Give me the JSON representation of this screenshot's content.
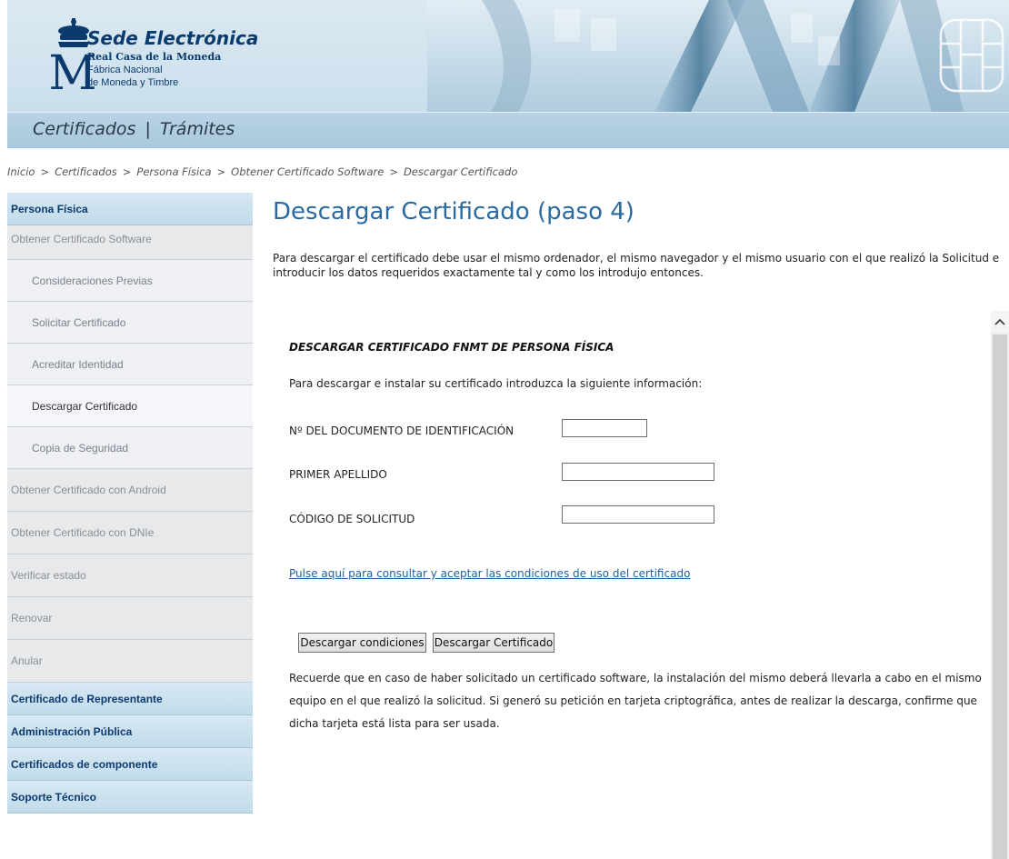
{
  "header": {
    "brand_title": "Sede Electrónica",
    "brand_sub1": "Real Casa de la Moneda",
    "brand_sub2": "Fábrica Nacional",
    "brand_sub3": "de Moneda y Timbre",
    "logo_letter": "M",
    "nav": {
      "certificados": "Certificados",
      "separator": "|",
      "tramites": "Trámites"
    }
  },
  "breadcrumb": {
    "separator": ">",
    "items": [
      "Inicio",
      "Certificados",
      "Persona Física",
      "Obtener Certificado Software",
      "Descargar Certificado"
    ]
  },
  "sidebar": {
    "items": [
      {
        "label": "Persona Física"
      },
      {
        "label": "Obtener Certificado Software"
      },
      {
        "label": "Consideraciones Previas"
      },
      {
        "label": "Solicitar Certificado"
      },
      {
        "label": "Acreditar Identidad"
      },
      {
        "label": "Descargar Certificado"
      },
      {
        "label": "Copia de Seguridad"
      },
      {
        "label": "Obtener Certificado con Android"
      },
      {
        "label": "Obtener Certificado con DNIe"
      },
      {
        "label": "Verificar estado"
      },
      {
        "label": "Renovar"
      },
      {
        "label": "Anular"
      },
      {
        "label": "Certificado de Representante"
      },
      {
        "label": "Administración Pública"
      },
      {
        "label": "Certificados de componente"
      },
      {
        "label": "Soporte Técnico"
      }
    ]
  },
  "main": {
    "title": "Descargar Certificado (paso 4)",
    "intro": "Para descargar el certificado debe usar el mismo ordenador, el mismo navegador y el mismo usuario con el que realizó la Solicitud e introducir los datos requeridos exactamente tal y como los introdujo entonces.",
    "form": {
      "heading": "DESCARGAR CERTIFICADO FNMT DE PERSONA FÍSICA",
      "instructions": "Para descargar e instalar su certificado introduzca la siguiente información:",
      "fields": [
        {
          "label": "Nº DEL DOCUMENTO DE IDENTIFICACIÓN",
          "value": ""
        },
        {
          "label": "PRIMER APELLIDO",
          "value": ""
        },
        {
          "label": "CÓDIGO DE SOLICITUD",
          "value": ""
        }
      ],
      "conditions_link": "Pulse aquí para consultar y aceptar las condiciones de uso del certificado",
      "btn_conditions": "Descargar condiciones",
      "btn_download": "Descargar Certificado",
      "note": "Recuerde que en caso de haber solicitado un certificado software, la instalación del mismo deberá llevarla a cabo en el mismo equipo en el que realizó la solicitud. Si generó su petición en tarjeta criptográfica, antes de realizar la descarga, confirme que dicha tarjeta está lista para ser usada."
    }
  },
  "icons": {
    "scroll_up": "chevron-up-icon",
    "crown": "crown-icon",
    "chip": "smart-card-chip-icon"
  },
  "colors": {
    "brand": "#0b3a6e",
    "title": "#2a6aa0",
    "link": "#1f5f9f",
    "header_bg": "#cfe2ee"
  }
}
